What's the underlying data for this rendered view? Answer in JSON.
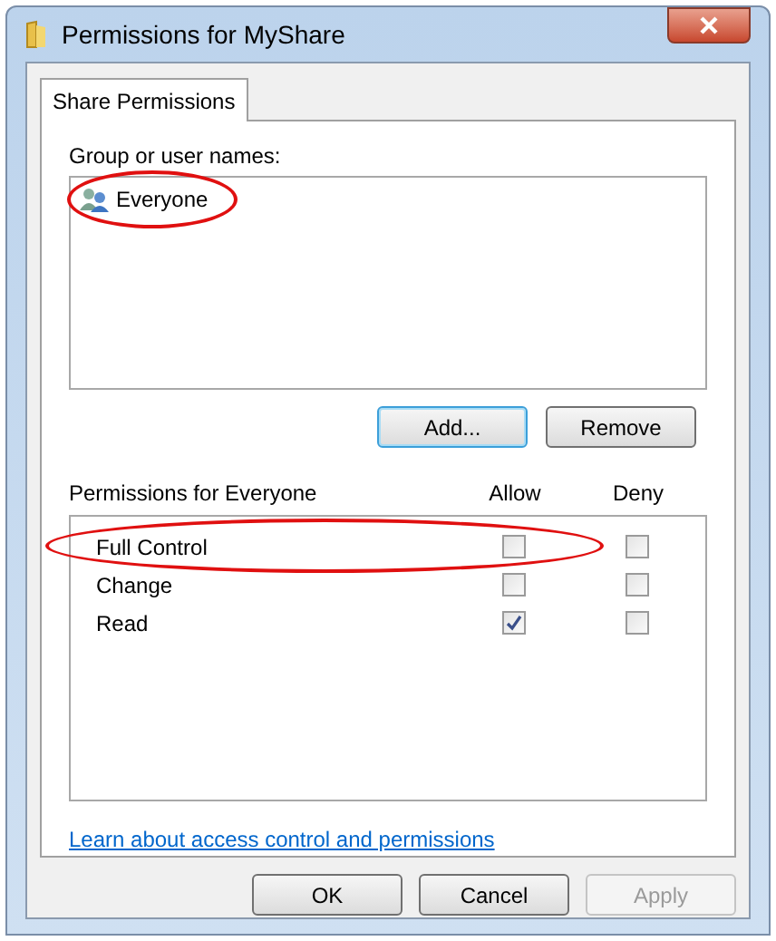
{
  "window": {
    "title": "Permissions for MyShare"
  },
  "tabs": [
    {
      "label": "Share Permissions",
      "selected": true
    }
  ],
  "group_label": "Group or user names:",
  "users": [
    {
      "name": "Everyone",
      "selected": false,
      "highlighted": true
    }
  ],
  "user_buttons": [
    {
      "label": "Add...",
      "default": true
    },
    {
      "label": "Remove",
      "default": false
    }
  ],
  "permissions": {
    "heading": "Permissions for Everyone",
    "columns": [
      "Allow",
      "Deny"
    ],
    "rows": [
      {
        "name": "Full Control",
        "allow": false,
        "deny": false,
        "highlighted": true
      },
      {
        "name": "Change",
        "allow": false,
        "deny": false,
        "highlighted": false
      },
      {
        "name": "Read",
        "allow": true,
        "deny": false,
        "highlighted": false
      }
    ]
  },
  "link": "Learn about access control and permissions",
  "buttons": [
    {
      "label": "OK",
      "disabled": false
    },
    {
      "label": "Cancel",
      "disabled": false
    },
    {
      "label": "Apply",
      "disabled": true
    }
  ]
}
